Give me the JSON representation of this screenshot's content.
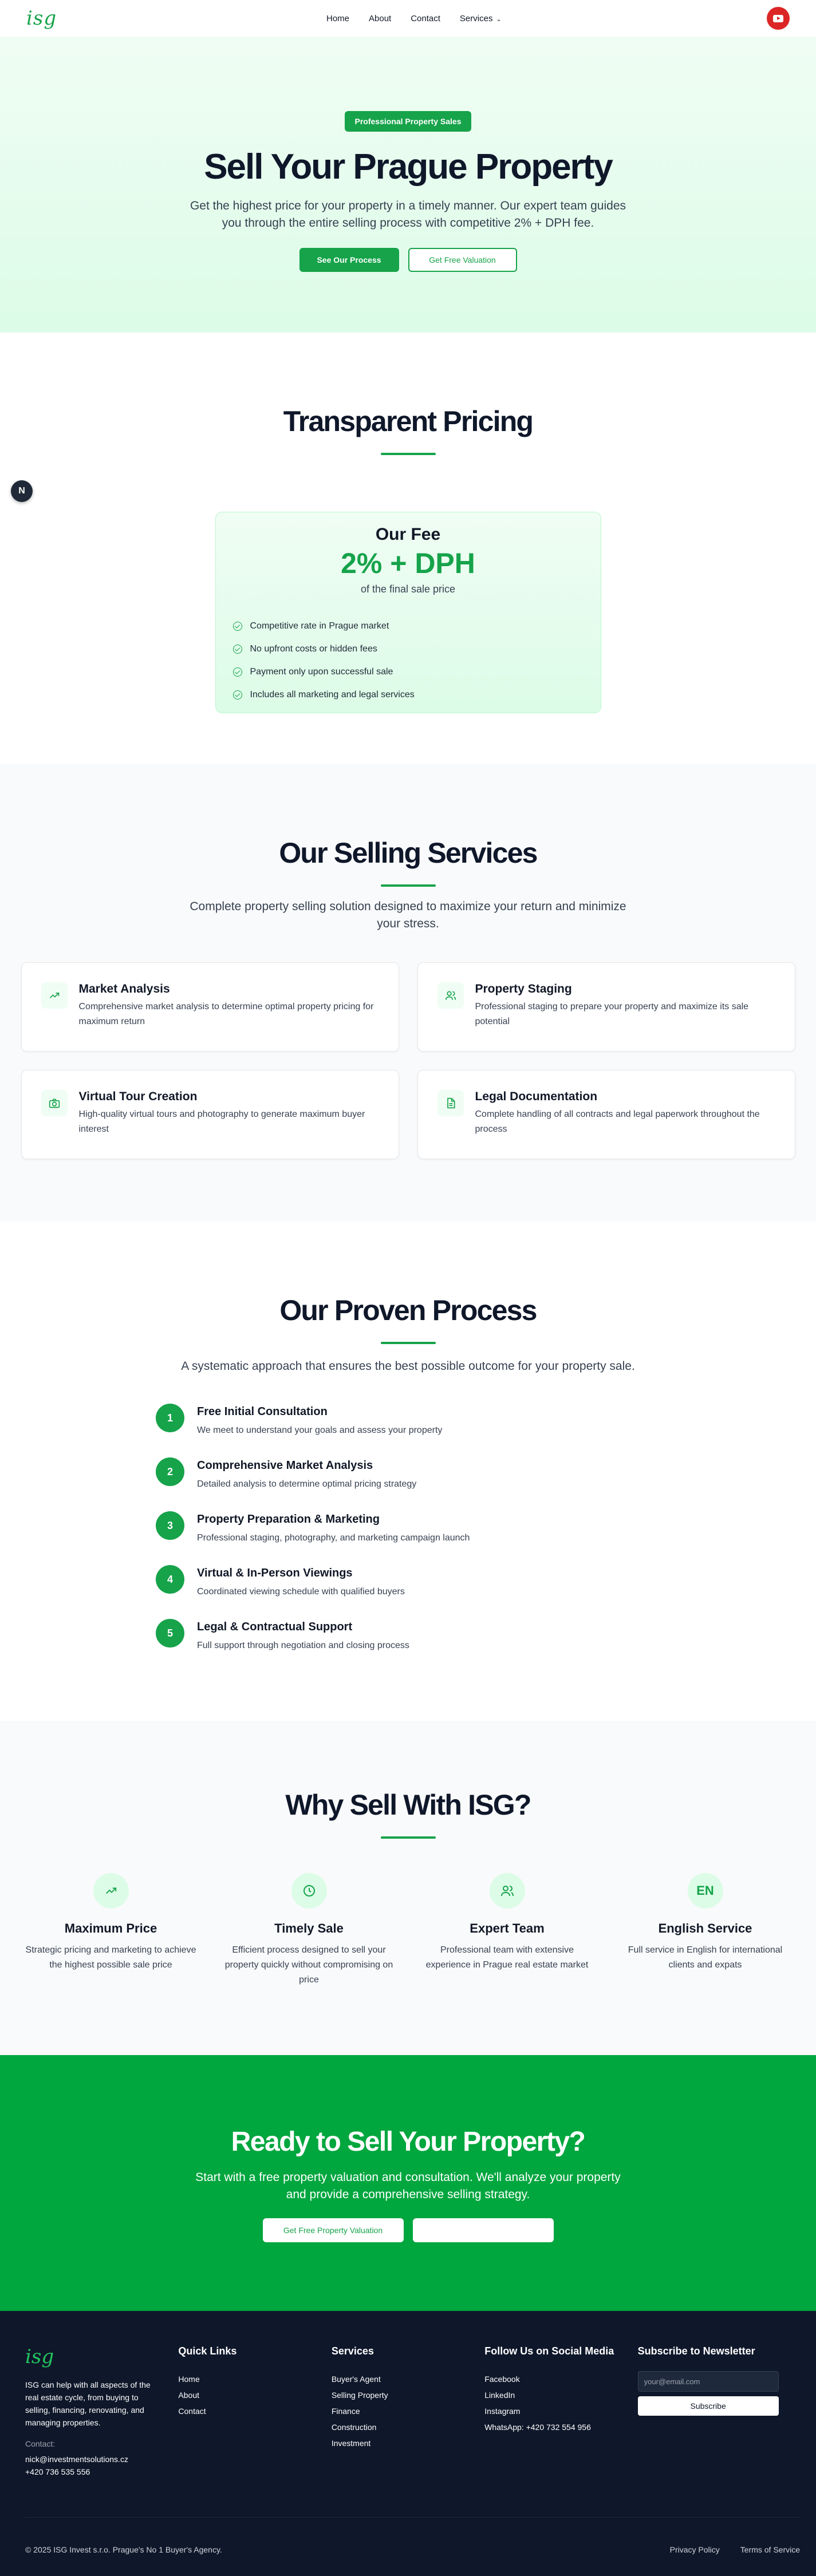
{
  "nav": {
    "logo": "isg",
    "links": [
      "Home",
      "About",
      "Contact",
      "Services"
    ],
    "youtube_icon": "youtube-icon",
    "colors": {
      "accent": "#16a34a",
      "youtube": "#dc2626"
    }
  },
  "hero": {
    "badge": "Professional Property Sales",
    "title": "Sell Your Prague Property",
    "subtitle": "Get the highest price for your property in a timely manner. Our expert team guides you through the entire selling process with competitive 2% + DPH fee.",
    "primary_button": "See Our Process",
    "secondary_button": "Get Free Valuation"
  },
  "pricing": {
    "title": "Transparent Pricing",
    "float_button": "N",
    "card": {
      "label": "Our Fee",
      "value": "2% + DPH",
      "note": "of the final sale price",
      "items": [
        "Competitive rate in Prague market",
        "No upfront costs or hidden fees",
        "Payment only upon successful sale",
        "Includes all marketing and legal services"
      ]
    }
  },
  "services": {
    "title": "Our Selling Services",
    "subtitle": "Complete property selling solution designed to maximize your return and minimize your stress.",
    "items": [
      {
        "title": "Market Analysis",
        "desc": "Comprehensive market analysis to determine optimal property pricing for maximum return",
        "icon": "trending-up-icon"
      },
      {
        "title": "Property Staging",
        "desc": "Professional staging to prepare your property and maximize its sale potential",
        "icon": "users-icon"
      },
      {
        "title": "Virtual Tour Creation",
        "desc": "High-quality virtual tours and photography to generate maximum buyer interest",
        "icon": "camera-icon"
      },
      {
        "title": "Legal Documentation",
        "desc": "Complete handling of all contracts and legal paperwork throughout the process",
        "icon": "document-icon"
      }
    ]
  },
  "process": {
    "title": "Our Proven Process",
    "subtitle": "A systematic approach that ensures the best possible outcome for your property sale.",
    "steps": [
      {
        "num": "1",
        "title": "Free Initial Consultation",
        "desc": "We meet to understand your goals and assess your property"
      },
      {
        "num": "2",
        "title": "Comprehensive Market Analysis",
        "desc": "Detailed analysis to determine optimal pricing strategy"
      },
      {
        "num": "3",
        "title": "Property Preparation & Marketing",
        "desc": "Professional staging, photography, and marketing campaign launch"
      },
      {
        "num": "4",
        "title": "Virtual & In-Person Viewings",
        "desc": "Coordinated viewing schedule with qualified buyers"
      },
      {
        "num": "5",
        "title": "Legal & Contractual Support",
        "desc": "Full support through negotiation and closing process"
      }
    ]
  },
  "why": {
    "title": "Why Sell With ISG?",
    "items": [
      {
        "title": "Maximum Price",
        "desc": "Strategic pricing and marketing to achieve the highest possible sale price",
        "icon": "trending-up-icon"
      },
      {
        "title": "Timely Sale",
        "desc": "Efficient process designed to sell your property quickly without compromising on price",
        "icon": "clock-icon"
      },
      {
        "title": "Expert Team",
        "desc": "Professional team with extensive experience in Prague real estate market",
        "icon": "users-icon"
      },
      {
        "title": "English Service",
        "desc": "Full service in English for international clients and expats",
        "badge": "EN"
      }
    ]
  },
  "cta": {
    "title": "Ready to Sell Your Property?",
    "subtitle": "Start with a free property valuation and consultation. We'll analyze your property and provide a comprehensive selling strategy.",
    "primary_button": "Get Free Property Valuation",
    "secondary_button": "",
    "color": "#00a63e"
  },
  "footer": {
    "logo": "isg",
    "about": "ISG can help with all aspects of the real estate cycle, from buying to selling, financing, renovating, and managing properties.",
    "contact_label": "Contact:",
    "email": "nick@investmentsolutions.cz",
    "phone": "+420 736 535 556",
    "quick_links": {
      "title": "Quick Links",
      "items": [
        "Home",
        "About",
        "Contact"
      ]
    },
    "services": {
      "title": "Services",
      "items": [
        "Buyer's Agent",
        "Selling Property",
        "Finance",
        "Construction",
        "Investment"
      ]
    },
    "social": {
      "title": "Follow Us on Social Media",
      "items": [
        "Facebook",
        "LinkedIn",
        "Instagram",
        "WhatsApp: +420 732 554 956"
      ]
    },
    "newsletter": {
      "title": "Subscribe to Newsletter",
      "placeholder": "your@email.com",
      "button": "Subscribe"
    },
    "copyright": "© 2025 ISG Invest s.r.o. Prague's No 1 Buyer's Agency.",
    "legal": [
      "Privacy Policy",
      "Terms of Service"
    ]
  }
}
